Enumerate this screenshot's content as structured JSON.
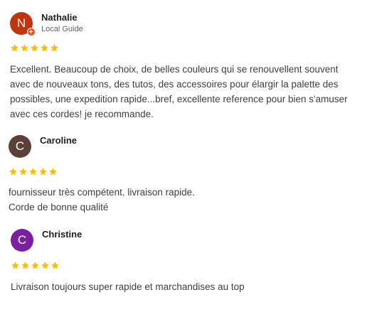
{
  "colors": {
    "star": "#fbbc04",
    "local_guide_badge": "#f4511e"
  },
  "reviews": [
    {
      "initial": "N",
      "avatar_color": "#bf360c",
      "name": "Nathalie",
      "subtitle": "Local Guide",
      "rating": 5,
      "text": "Excellent. Beaucoup de choix, de belles couleurs qui se renouvellent souvent avec de nouveaux tons, des tutos, des accessoires pour élargir la palette des possibles, une expedition rapide...bref, excellente reference pour bien s'amuser avec ces cordes! je recommande."
    },
    {
      "initial": "C",
      "avatar_color": "#5d4037",
      "name": "Caroline",
      "rating": 5,
      "text_lines": [
        "fournisseur très compétent. livraison rapide.",
        "Corde de bonne qualité"
      ]
    },
    {
      "initial": "C",
      "avatar_color": "#7b1fa2",
      "name": "Christine",
      "rating": 5,
      "text": "Livraison toujours super rapide et marchandises au top"
    }
  ]
}
